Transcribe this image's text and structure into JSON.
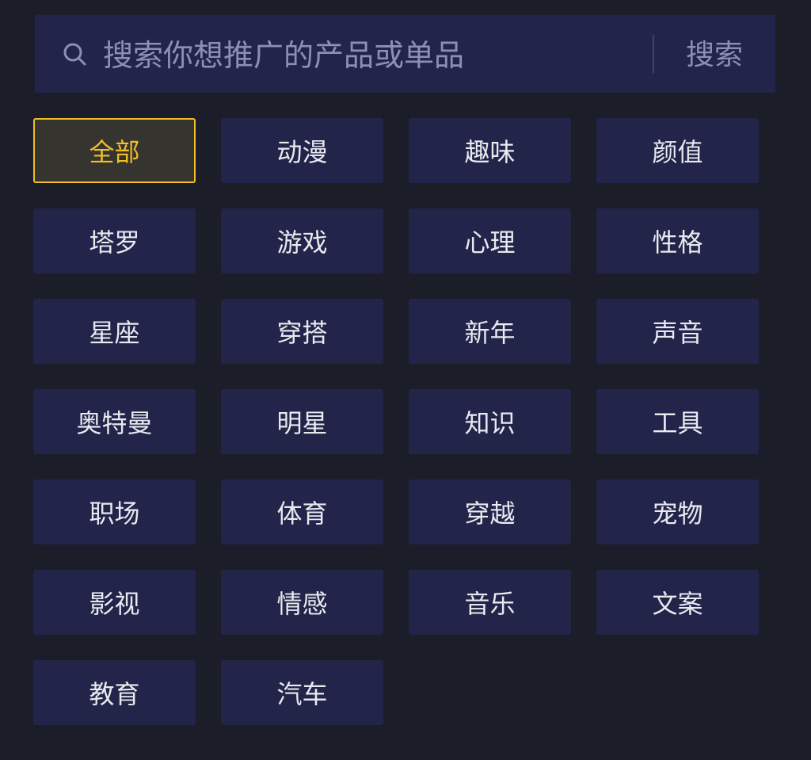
{
  "search": {
    "placeholder": "搜索你想推广的产品或单品",
    "value": "",
    "button_label": "搜索",
    "icon": "search-icon"
  },
  "tags": [
    {
      "label": "全部",
      "selected": true
    },
    {
      "label": "动漫",
      "selected": false
    },
    {
      "label": "趣味",
      "selected": false
    },
    {
      "label": "颜值",
      "selected": false
    },
    {
      "label": "塔罗",
      "selected": false
    },
    {
      "label": "游戏",
      "selected": false
    },
    {
      "label": "心理",
      "selected": false
    },
    {
      "label": "性格",
      "selected": false
    },
    {
      "label": "星座",
      "selected": false
    },
    {
      "label": "穿搭",
      "selected": false
    },
    {
      "label": "新年",
      "selected": false
    },
    {
      "label": "声音",
      "selected": false
    },
    {
      "label": "奥特曼",
      "selected": false
    },
    {
      "label": "明星",
      "selected": false
    },
    {
      "label": "知识",
      "selected": false
    },
    {
      "label": "工具",
      "selected": false
    },
    {
      "label": "职场",
      "selected": false
    },
    {
      "label": "体育",
      "selected": false
    },
    {
      "label": "穿越",
      "selected": false
    },
    {
      "label": "宠物",
      "selected": false
    },
    {
      "label": "影视",
      "selected": false
    },
    {
      "label": "情感",
      "selected": false
    },
    {
      "label": "音乐",
      "selected": false
    },
    {
      "label": "文案",
      "selected": false
    },
    {
      "label": "教育",
      "selected": false
    },
    {
      "label": "汽车",
      "selected": false
    }
  ],
  "colors": {
    "background": "#1b1d29",
    "panel": "#22244a",
    "text": "#e9e9f0",
    "muted_text": "#8c8fb8",
    "accent": "#f0bf2a",
    "selected_bg": "#35342f"
  }
}
